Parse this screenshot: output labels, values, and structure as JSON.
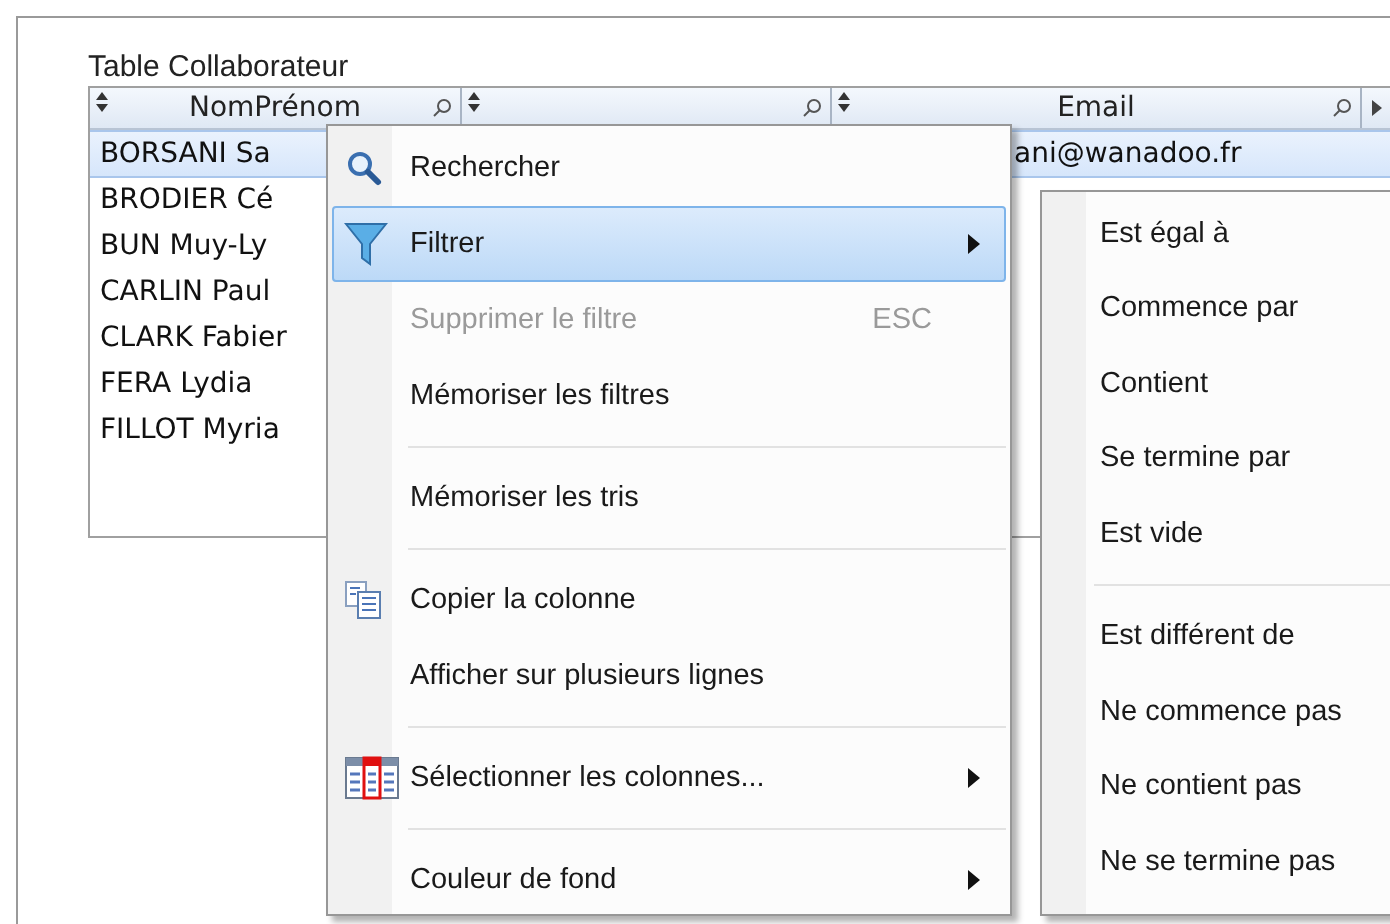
{
  "panel": {
    "title": "Table Collaborateur"
  },
  "table": {
    "columns": [
      {
        "label": "NomPrénom"
      },
      {},
      {
        "label": "Email"
      }
    ],
    "rows": [
      {
        "name": "BORSANI Sa",
        "email": "ani@wanadoo.fr",
        "selected": true
      },
      {
        "name": "BRODIER Cé",
        "selected": false
      },
      {
        "name": "BUN Muy-Ly",
        "selected": false
      },
      {
        "name": "CARLIN Paul",
        "selected": false
      },
      {
        "name": "CLARK Fabier",
        "selected": false
      },
      {
        "name": "FERA Lydia",
        "selected": false
      },
      {
        "name": "FILLOT Myria",
        "selected": false
      }
    ]
  },
  "context_menu": {
    "items": [
      {
        "kind": "item",
        "label": "Rechercher",
        "highlighted": false,
        "disabled": false
      },
      {
        "kind": "item",
        "label": "Filtrer",
        "highlighted": true,
        "disabled": false,
        "submenu": true
      },
      {
        "kind": "item",
        "label": "Supprimer le filtre",
        "shortcut": "ESC",
        "highlighted": false,
        "disabled": true
      },
      {
        "kind": "item",
        "label": "Mémoriser les filtres",
        "highlighted": false,
        "disabled": false
      },
      {
        "kind": "separator"
      },
      {
        "kind": "item",
        "label": "Mémoriser les tris",
        "highlighted": false,
        "disabled": false
      },
      {
        "kind": "separator"
      },
      {
        "kind": "item",
        "label": "Copier la colonne",
        "highlighted": false,
        "disabled": false
      },
      {
        "kind": "item",
        "label": "Afficher sur plusieurs lignes",
        "highlighted": false,
        "disabled": false
      },
      {
        "kind": "separator"
      },
      {
        "kind": "item",
        "label": "Sélectionner les colonnes...",
        "highlighted": false,
        "disabled": false,
        "submenu": true
      },
      {
        "kind": "separator"
      },
      {
        "kind": "item",
        "label": "Couleur de fond",
        "highlighted": false,
        "disabled": false,
        "submenu": true
      }
    ]
  },
  "submenu": {
    "items": [
      {
        "kind": "item",
        "label": "Est égal à"
      },
      {
        "kind": "item",
        "label": "Commence par"
      },
      {
        "kind": "item",
        "label": "Contient"
      },
      {
        "kind": "item",
        "label": "Se termine par"
      },
      {
        "kind": "item",
        "label": "Est vide"
      },
      {
        "kind": "separator"
      },
      {
        "kind": "item",
        "label": "Est différent de"
      },
      {
        "kind": "item",
        "label": "Ne commence pas"
      },
      {
        "kind": "item",
        "label": "Ne contient pas"
      },
      {
        "kind": "item",
        "label": "Ne se termine pas"
      }
    ]
  }
}
